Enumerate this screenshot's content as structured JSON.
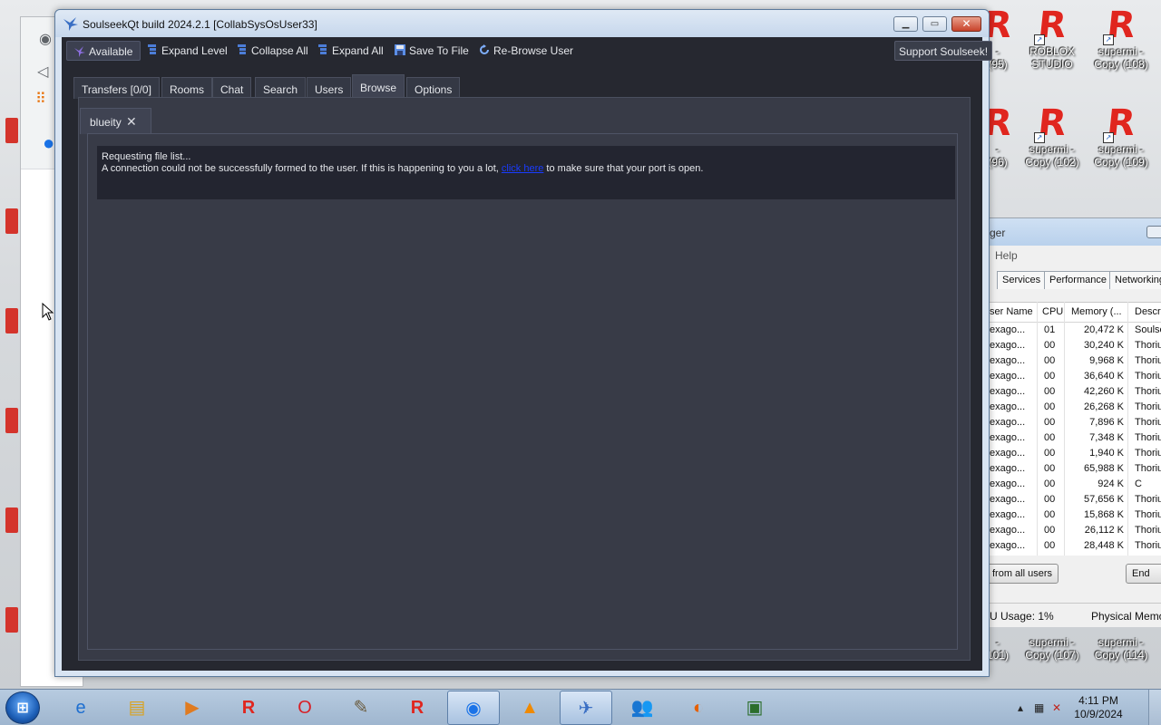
{
  "desktop": {
    "icons": [
      {
        "lines": [
          "ROBLOX",
          "STUDIO"
        ]
      },
      {
        "lines": [
          "supermi -",
          "Copy (108)"
        ]
      },
      {
        "lines": [
          "supermi -",
          "Copy (102)"
        ]
      },
      {
        "lines": [
          "supermi -",
          "Copy (109)"
        ]
      },
      {
        "lines": [
          "supermi -",
          "Copy (107)"
        ]
      },
      {
        "lines": [
          "supermi -",
          "Copy (114)"
        ]
      }
    ],
    "partial_labels": [
      "(95)",
      "(96)",
      "101)"
    ]
  },
  "soulseek": {
    "title": "SoulseekQt build 2024.2.1 [CollabSysOsUser33]",
    "toolbar": {
      "available": "Available",
      "expand_level": "Expand Level",
      "collapse_all": "Collapse All",
      "expand_all": "Expand All",
      "save_to_file": "Save To File",
      "rebrowse_user": "Re-Browse User",
      "support": "Support Soulseek!"
    },
    "tabs": [
      "Transfers [0/0]",
      "Rooms",
      "Chat",
      "Search",
      "Users",
      "Browse",
      "Options"
    ],
    "active_tab": "Browse",
    "user_tab": "blueity",
    "message": {
      "line1": "Requesting file list...",
      "line2_before": "A connection could not be successfully formed to the user. If this is happening to you a lot,",
      "link": "click here",
      "line2_after": "to make sure that your port is open."
    }
  },
  "task_manager": {
    "title_partial": "ger",
    "menu_partial": "Help",
    "tabs": [
      "Services",
      "Performance",
      "Networking"
    ],
    "columns": [
      "ser Name",
      "CPU",
      "Memory (...",
      "Descri"
    ],
    "rows": [
      {
        "user": "exago...",
        "cpu": "01",
        "mem": "20,472 K",
        "desc": "Soulse"
      },
      {
        "user": "exago...",
        "cpu": "00",
        "mem": "30,240 K",
        "desc": "Thoriu"
      },
      {
        "user": "exago...",
        "cpu": "00",
        "mem": "9,968 K",
        "desc": "Thoriu"
      },
      {
        "user": "exago...",
        "cpu": "00",
        "mem": "36,640 K",
        "desc": "Thoriu"
      },
      {
        "user": "exago...",
        "cpu": "00",
        "mem": "42,260 K",
        "desc": "Thoriu"
      },
      {
        "user": "exago...",
        "cpu": "00",
        "mem": "26,268 K",
        "desc": "Thoriu"
      },
      {
        "user": "exago...",
        "cpu": "00",
        "mem": "7,896 K",
        "desc": "Thoriu"
      },
      {
        "user": "exago...",
        "cpu": "00",
        "mem": "7,348 K",
        "desc": "Thoriu"
      },
      {
        "user": "exago...",
        "cpu": "00",
        "mem": "1,940 K",
        "desc": "Thoriu"
      },
      {
        "user": "exago...",
        "cpu": "00",
        "mem": "65,988 K",
        "desc": "Thoriu"
      },
      {
        "user": "exago...",
        "cpu": "00",
        "mem": "924 K",
        "desc": "C"
      },
      {
        "user": "exago...",
        "cpu": "00",
        "mem": "57,656 K",
        "desc": "Thoriu"
      },
      {
        "user": "exago...",
        "cpu": "00",
        "mem": "15,868 K",
        "desc": "Thoriu"
      },
      {
        "user": "exago...",
        "cpu": "00",
        "mem": "26,112 K",
        "desc": "Thoriu"
      },
      {
        "user": "exago...",
        "cpu": "00",
        "mem": "28,448 K",
        "desc": "Thoriu"
      }
    ],
    "btn_all_users": "from all users",
    "btn_end": "End",
    "status_cpu": "U Usage: 1%",
    "status_mem": "Physical Memo"
  },
  "taskbar": {
    "apps": [
      "internet-explorer",
      "file-explorer",
      "media-player",
      "roblox",
      "opera",
      "gimp",
      "roblox-studio",
      "chromium",
      "vlc",
      "soulseek",
      "messenger",
      "firefox",
      "terminal"
    ],
    "clock_time": "4:11 PM",
    "clock_date": "10/9/2024"
  },
  "colors": {
    "soulseek_bg": "#262830",
    "panel_bg": "#383b47",
    "link": "#1a3cff",
    "roblox_red": "#e0261f"
  }
}
